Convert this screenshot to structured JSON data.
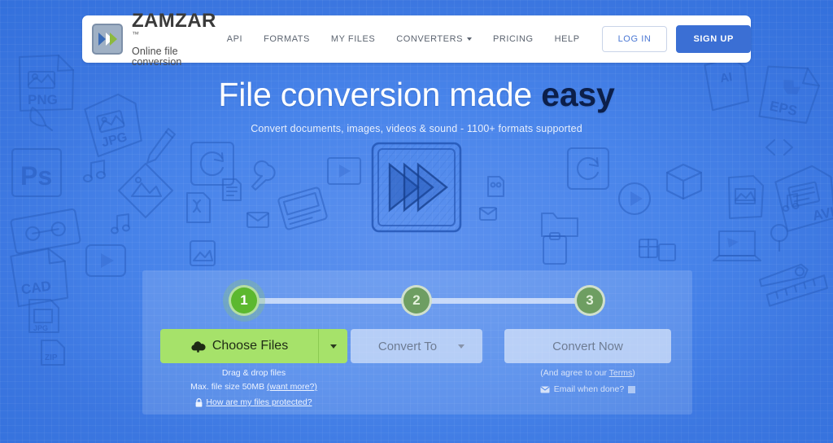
{
  "brand": {
    "name": "ZAMZAR",
    "trademark": "™",
    "tagline": "Online file conversion",
    "logo_icon": "double-chevron-logo-icon",
    "logo_blue": "#3A6BB5",
    "logo_green": "#8CB93E"
  },
  "nav": {
    "links": [
      {
        "label": "API",
        "name": "nav-api"
      },
      {
        "label": "FORMATS",
        "name": "nav-formats"
      },
      {
        "label": "MY FILES",
        "name": "nav-my-files"
      },
      {
        "label": "CONVERTERS",
        "name": "nav-converters",
        "has_caret": true
      },
      {
        "label": "PRICING",
        "name": "nav-pricing"
      },
      {
        "label": "HELP",
        "name": "nav-help"
      }
    ],
    "login_label": "LOG IN",
    "signup_label": "SIGN UP",
    "signup_color": "#3B6FD4",
    "login_text_color": "#4B78D4"
  },
  "hero": {
    "headline_normal": "File conversion made ",
    "headline_bold": "easy",
    "subhead": "Convert documents, images, videos & sound - 1100+ formats supported",
    "illustration_icon": "fast-forward-play-sketch-icon"
  },
  "widget": {
    "steps": [
      {
        "number": "1",
        "state": "active"
      },
      {
        "number": "2",
        "state": "idle"
      },
      {
        "number": "3",
        "state": "idle"
      }
    ],
    "active_step_color": "#5CB82F",
    "idle_step_color": "#6E9E62",
    "choose_files": {
      "label": "Choose Files",
      "icon": "cloud-upload-icon",
      "dropdown_icon": "caret-down-icon",
      "color": "#A6E26A"
    },
    "convert_to": {
      "label": "Convert To",
      "dropdown_icon": "caret-down-icon"
    },
    "convert_now": {
      "label": "Convert Now"
    },
    "notes_left": {
      "drag_drop": "Drag & drop files",
      "max_size_prefix": "Max. file size 50MB ",
      "want_more_link": "(want more?)",
      "lock_icon": "lock-icon",
      "protected_link": "How are my files protected?"
    },
    "notes_right": {
      "agree_prefix": "(And agree to our ",
      "terms_link": "Terms",
      "agree_suffix": ")",
      "envelope_icon": "envelope-icon",
      "email_label": "Email when done?",
      "checkbox_name": "email-when-done-checkbox"
    }
  },
  "background": {
    "doodle_labels": [
      "PNG",
      "JPG",
      "Ps",
      "CAD",
      "EPS",
      "AVI",
      "AI"
    ],
    "style": "hand-drawn-sketch-file-icons",
    "base_color": "#4884EA"
  }
}
